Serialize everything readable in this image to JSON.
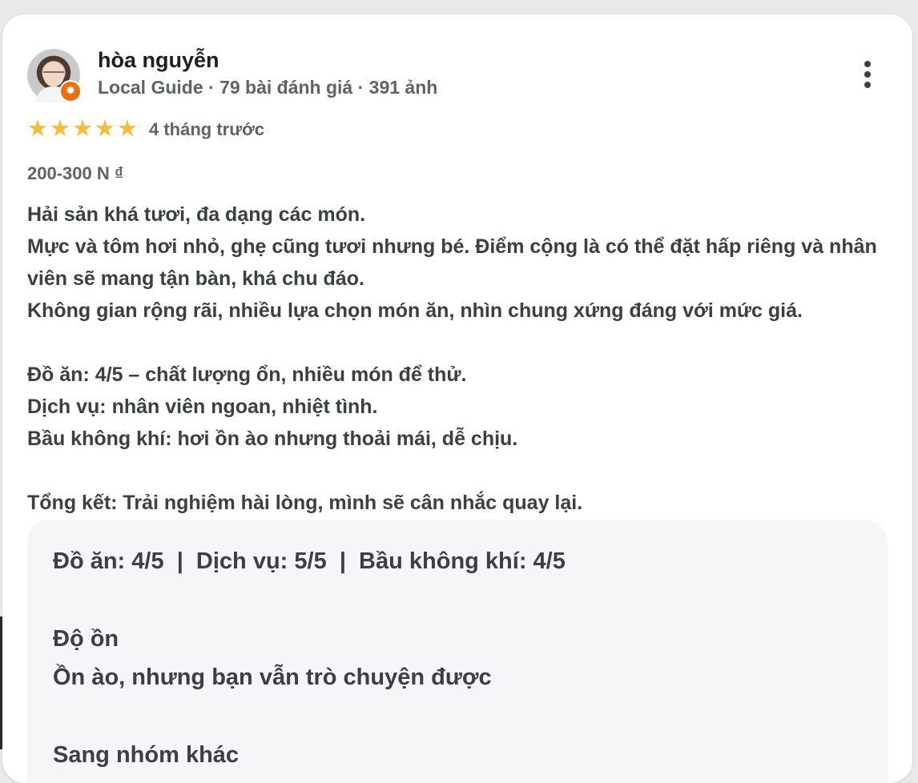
{
  "review": {
    "author_name": "hòa nguyễn",
    "author_meta": "Local Guide · 79 bài đánh giá · 391 ảnh",
    "rating": 5,
    "date": "4 tháng trước",
    "price_range": "200-300 N ₫",
    "text": "Hải sản khá tươi, đa dạng các món.\nMực và tôm hơi nhỏ, ghẹ cũng tươi nhưng bé. Điểm cộng là có thể đặt hấp riêng và nhân viên sẽ mang tận bàn, khá chu đáo.\nKhông gian rộng rãi, nhiều lựa chọn món ăn, nhìn chung xứng đáng với mức giá.\n\nĐồ ăn: 4/5 – chất lượng ổn, nhiều món để thử.\nDịch vụ: nhân viên ngoan, nhiệt tình.\nBầu không khí: hơi ồn ào nhưng thoải mái, dễ chịu.\n\nTổng kết: Trải nghiệm hài lòng, mình sẽ cân nhắc quay lại."
  },
  "details": {
    "ratings_summary": "Đồ ăn: 4/5  |  Dịch vụ: 5/5  |  Bầu không khí: 4/5",
    "noise_label": "Độ ồn",
    "noise_value": "Ồn ào, nhưng bạn vẫn trò chuyện được",
    "next_label_partial": "Sang nhóm khác"
  },
  "icons": {
    "star": "star-icon",
    "more": "more-vert-icon",
    "guide_badge": "local-guide-badge-icon"
  },
  "colors": {
    "star": "#f4bd3a",
    "guide_badge": "#e8710a"
  }
}
